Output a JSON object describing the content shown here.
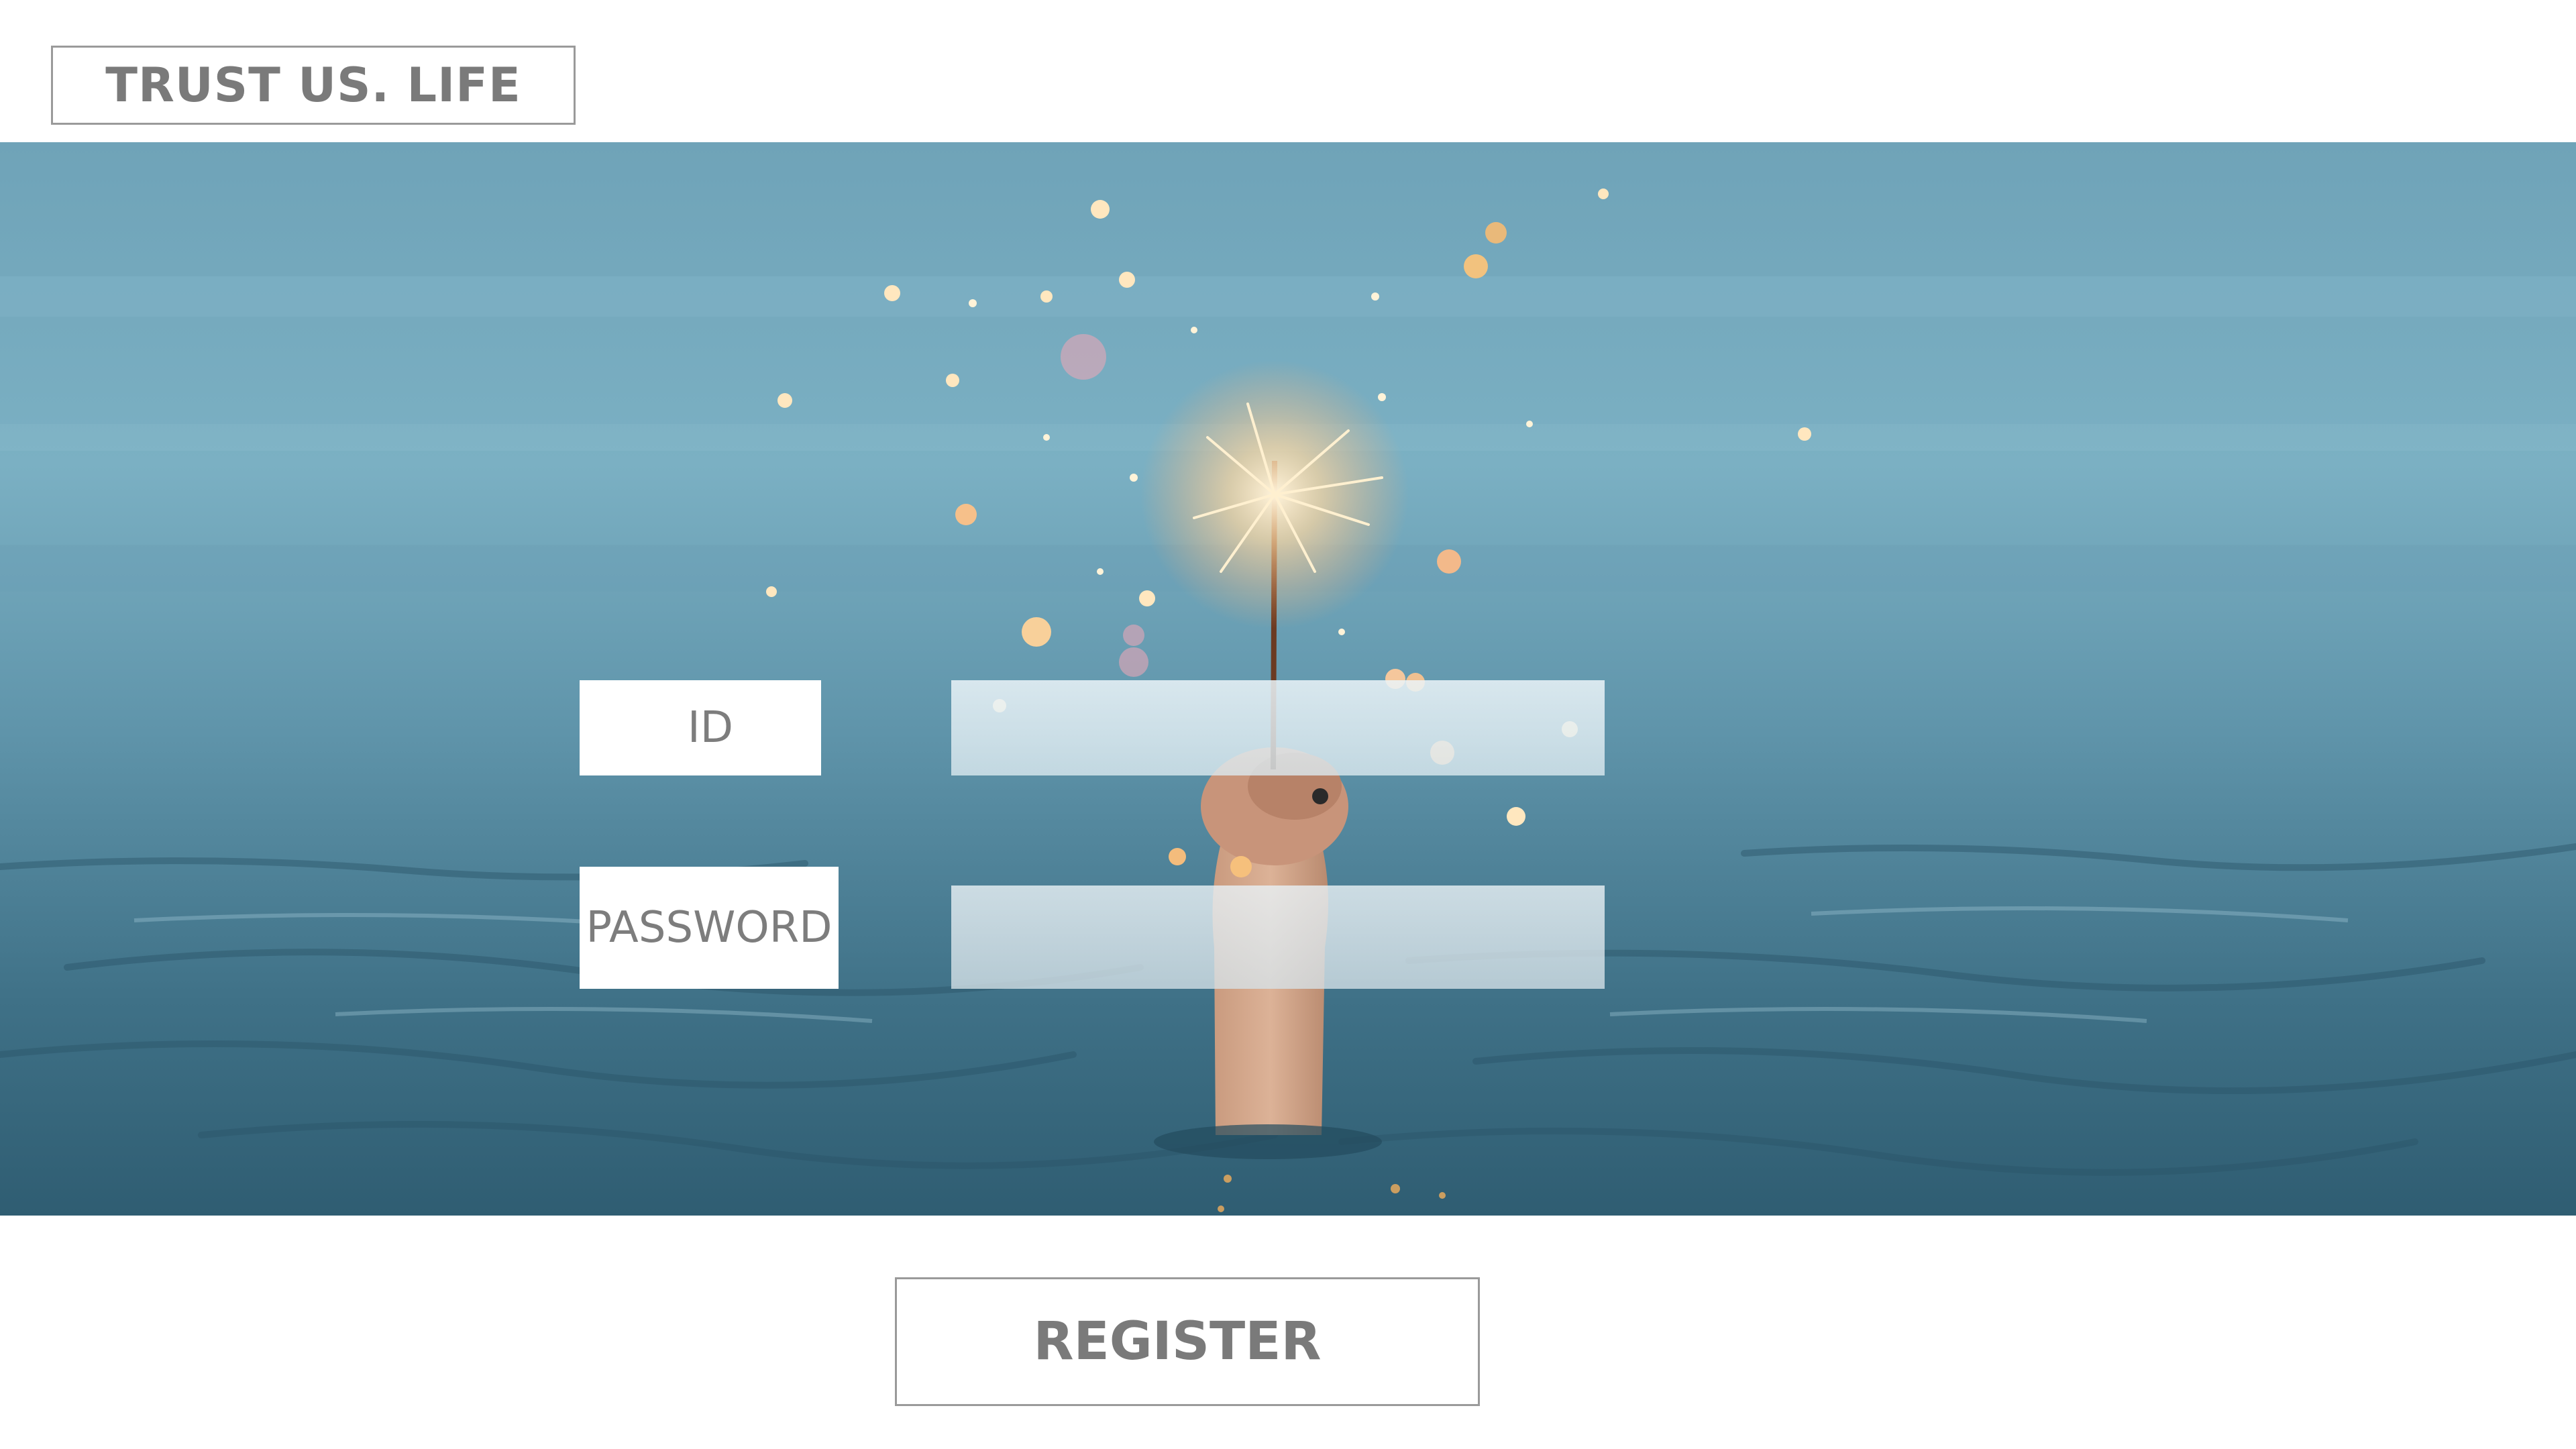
{
  "brand": {
    "name": "TRUST US. LIFE"
  },
  "hero": {
    "image": "hand-holding-sparkler-above-sea",
    "colors": {
      "sky": "#7fb0c4",
      "sea": "#4a7f95",
      "sparks": "#ffd9a0"
    }
  },
  "login_form": {
    "id_label": "ID",
    "id_value": "",
    "password_label": "PASSWORD",
    "password_value": ""
  },
  "register": {
    "label": "REGISTER"
  }
}
